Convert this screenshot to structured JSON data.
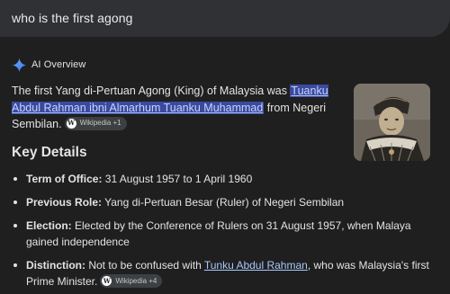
{
  "search": {
    "query": "who is the first agong"
  },
  "ai_overview": {
    "title": "AI Overview",
    "icon": "sparkle-icon",
    "accent": "#4b8cf5",
    "intro_prefix": "The first Yang di-Pertuan Agong (King) of Malaysia was ",
    "intro_link": "Tuanku Abdul Rahman ibni Almarhum Tuanku Muhammad",
    "intro_suffix": " from Negeri Sembilan.",
    "intro_source": "Wikipedia +1"
  },
  "key_details": {
    "heading": "Key Details",
    "items": [
      {
        "term": "Term of Office:",
        "text": " 31 August 1957 to 1 April 1960"
      },
      {
        "term": "Previous Role:",
        "text": " Yang di-Pertuan Besar (Ruler) of Negeri Sembilan"
      },
      {
        "term": "Election:",
        "text": " Elected by the Conference of Rulers on 31 August 1957, when Malaya gained independence"
      },
      {
        "term": "Distinction:",
        "text": " Not to be confused with ",
        "link": "Tunku Abdul Rahman",
        "text_after": ", who was Malaysia's first Prime Minister.",
        "source": "Wikipedia +4"
      }
    ]
  }
}
